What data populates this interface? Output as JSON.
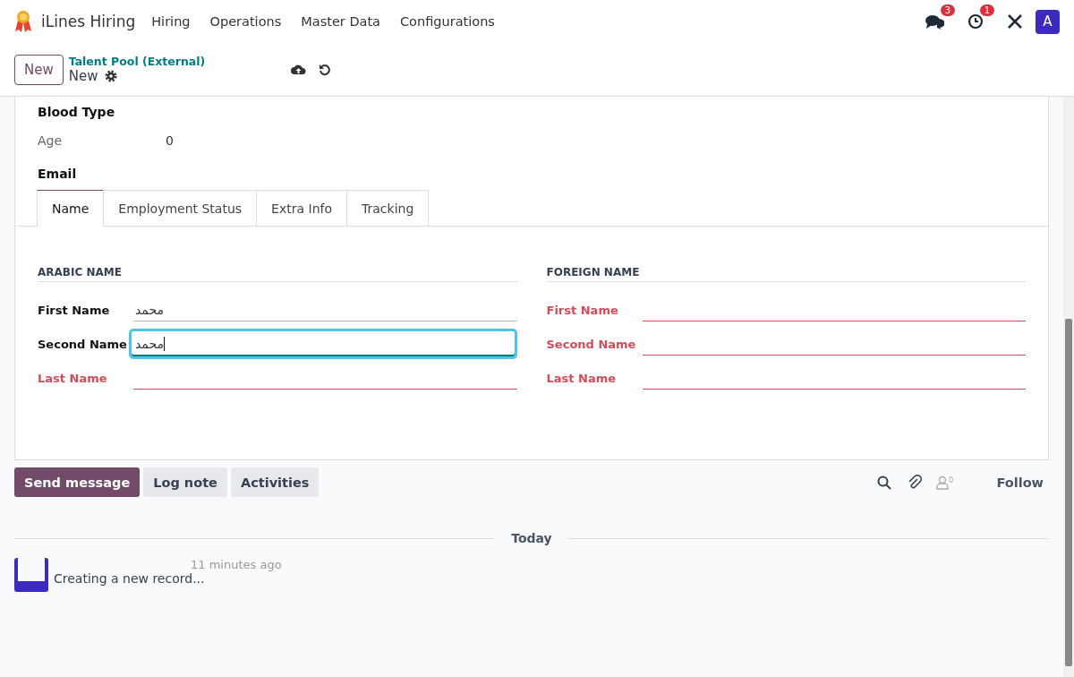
{
  "navbar": {
    "app_name": "iLines Hiring",
    "menu": [
      "Hiring",
      "Operations",
      "Master Data",
      "Configurations"
    ],
    "messages_badge": "3",
    "activities_badge": "1",
    "avatar": "A"
  },
  "control_panel": {
    "new_button": "New",
    "breadcrumb": "Talent Pool (External)",
    "record": "New"
  },
  "top_fields": [
    {
      "label": "Blood Type",
      "kind": "bold"
    },
    {
      "label": "Age",
      "value": "0",
      "kind": "plain"
    },
    {
      "label": "Email",
      "kind": "bold"
    }
  ],
  "tabs": [
    {
      "label": "Name",
      "selected": true
    },
    {
      "label": "Employment Status",
      "selected": false
    },
    {
      "label": "Extra Info",
      "selected": false
    },
    {
      "label": "Tracking",
      "selected": false
    }
  ],
  "groups": [
    {
      "title": "ARABIC NAME",
      "fields": [
        {
          "label": "First Name",
          "value": "محمد",
          "required": false,
          "focused": false
        },
        {
          "label": "Second Name",
          "value": "محمد",
          "required": false,
          "focused": true
        },
        {
          "label": "Last Name",
          "required": true,
          "focused": false
        }
      ]
    },
    {
      "title": "FOREIGN NAME",
      "fields": [
        {
          "label": "First Name",
          "required": true,
          "focused": false
        },
        {
          "label": "Second Name",
          "required": true,
          "focused": false
        },
        {
          "label": "Last Name",
          "required": true,
          "focused": false
        }
      ]
    }
  ],
  "chatter": {
    "buttons": [
      {
        "label": "Send message",
        "selected": true
      },
      {
        "label": "Log note",
        "selected": false
      },
      {
        "label": "Activities",
        "selected": false
      }
    ],
    "followers_count": "0",
    "follow": "Follow",
    "date_separator": "Today",
    "message": {
      "time": "11 minutes ago",
      "body": "Creating a new record..."
    }
  }
}
